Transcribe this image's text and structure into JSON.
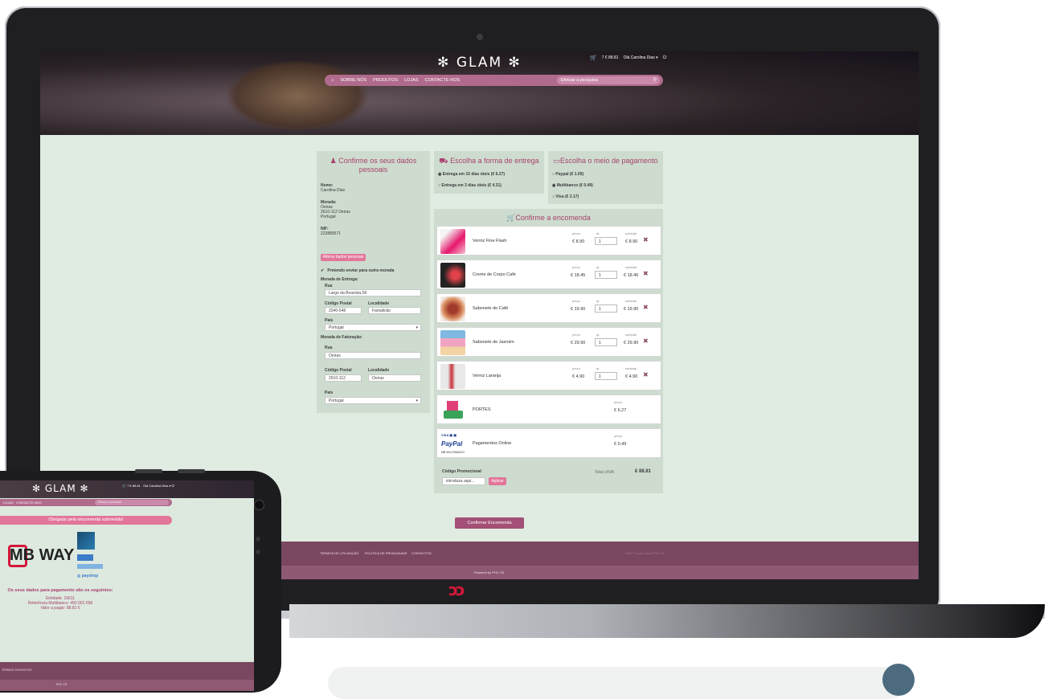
{
  "site": {
    "logo": "✻ GLAM ✻",
    "cart_summary": "7 € 88.81",
    "user_greeting": "Olá Carolina Dias ▾",
    "nav": [
      "SOBRE NÓS",
      "PRODUTOS",
      "LOJAS",
      "CONTACTE-NOS"
    ],
    "search_placeholder": "Efetuar a pesquisa"
  },
  "personal": {
    "title": "Confirme os seus dados pessoais",
    "name_label": "Nome:",
    "name_value": "Carolina Dias",
    "address_label": "Morada:",
    "address_line1": "Oeiras",
    "address_line2": "2610-112 Oeiras",
    "address_line3": "Portugal",
    "nif_label": "NIF:",
    "nif_value": "223889571",
    "change_button": "Alterar dados pessoais",
    "other_address_text": "Pretendo enviar para outra morada",
    "delivery_heading": "Morada de Entrega:",
    "rua_label": "Rua",
    "rua_value": "Largo da Boavista,56",
    "cp_label": "Código Postal",
    "cp_value": "2340-548",
    "loc_label": "Localidade",
    "loc_value": "Famalicão",
    "pais_label": "País",
    "pais_value": "Portugal",
    "billing_heading": "Morada de Faturação:",
    "billing_rua_label": "Rua",
    "billing_rua_value": "Oeiras",
    "billing_cp_label": "Código Postal",
    "billing_cp_value": "2610-112",
    "billing_loc_label": "Localidade",
    "billing_loc_value": "Oeiras",
    "billing_pais_label": "País",
    "billing_pais_value": "Portugal"
  },
  "delivery": {
    "title": "Escolha a forma de entrega",
    "options": [
      "Entrega em 10 dias úteis (€ 6.27)",
      "Entrega em 3 dias úteis (€ 4.31)"
    ]
  },
  "payment": {
    "title": "Escolha o meio de pagamento",
    "options": [
      "Paypal (€ 1.09)",
      "Multibanco (€ 0.49)",
      "Visa (€ 2.17)"
    ]
  },
  "order": {
    "title": "Confirme a encomenda",
    "col_price": "preço",
    "col_qty": "qt.",
    "col_subtotal": "subtotal",
    "items": [
      {
        "name": "Verniz Fine Flash",
        "price": "€ 8.90",
        "qty": "1",
        "subtotal": "€ 8.90"
      },
      {
        "name": "Creme de Corpo Café",
        "price": "€ 18.45",
        "qty": "1",
        "subtotal": "€ 18.45"
      },
      {
        "name": "Sabonete de Café",
        "price": "€ 19.90",
        "qty": "1",
        "subtotal": "€ 19.90"
      },
      {
        "name": "Sabonete de Jasmim",
        "price": "€ 29.90",
        "qty": "1",
        "subtotal": "€ 29.90"
      },
      {
        "name": "Verniz Laranja",
        "price": "€ 4.90",
        "qty": "1",
        "subtotal": "€ 4.90"
      }
    ],
    "portes_name": "PORTES",
    "portes_price": "€ 6.27",
    "online_name": "Pagamentos Online",
    "online_price": "€ 0.49",
    "promo_label": "Código Promocional",
    "promo_placeholder": "introduza aqui...",
    "apply_button": "Aplicar",
    "total_label": "Total c/IVA:",
    "total_value": "€ 88.81",
    "confirm_button": "Confirmar Encomenda"
  },
  "footer": {
    "links": [
      "TERMOS DE UTILIZAÇÃO",
      "POLÍTICA DE PRIVACIDADE",
      "CONTACTOS"
    ],
    "copyright": "2017 © Loja Glam PHC CS",
    "powered": "Powered by PHC CS"
  },
  "phone": {
    "logo": "✻ GLAM ✻",
    "nav": [
      "LOJAS",
      "CONTACTE-NOS"
    ],
    "search_placeholder": "Efetuar a pesquisa",
    "thanks": "Obrigado pela encomenda submetida!",
    "mbway": "MB WAY",
    "info_heading": "Os seus dados para pagamento são os seguintes:",
    "entity": "Entidade: 10611",
    "reference": "Referência Multibanco: 450 001 658",
    "amount": "Valor a pagar: 88.81 €",
    "footer_links": "TERMOS   CONTACTOS",
    "powered": "PHC CS"
  }
}
